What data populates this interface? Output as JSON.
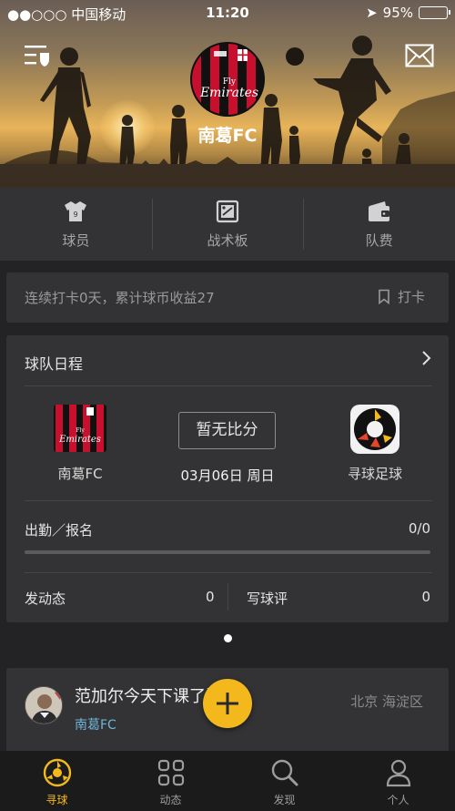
{
  "status_bar": {
    "carrier": "●●○○○ 中国移动",
    "time": "11:20",
    "battery": "95%",
    "battery_level": 0.95
  },
  "header": {
    "team_name": "南葛FC",
    "logo_brand": "Emirates",
    "logo_fly": "Fly"
  },
  "nav": [
    {
      "label": "球员",
      "icon": "jersey-icon"
    },
    {
      "label": "战术板",
      "icon": "tactics-board-icon"
    },
    {
      "label": "队费",
      "icon": "wallet-icon"
    }
  ],
  "checkin": {
    "text": "连续打卡0天，累计球币收益27",
    "button": "打卡"
  },
  "schedule": {
    "title": "球队日程",
    "home_team": "南葛FC",
    "away_team": "寻球足球",
    "score_label": "暂无比分",
    "date": "03月06日 周日",
    "attendance_label": "出勤／报名",
    "attendance_value": "0/0",
    "attendance_fraction": 0,
    "post_label": "发动态",
    "post_count": "0",
    "review_label": "写球评",
    "review_count": "0"
  },
  "feed": {
    "title": "范加尔今天下课了没有",
    "team": "南葛FC",
    "location": "北京 海淀区"
  },
  "tabbar": [
    {
      "label": "寻球",
      "icon": "ball-logo-icon",
      "active": true
    },
    {
      "label": "动态",
      "icon": "grid-icon",
      "active": false
    },
    {
      "label": "发现",
      "icon": "search-icon",
      "active": false
    },
    {
      "label": "个人",
      "icon": "person-icon",
      "active": false
    }
  ],
  "colors": {
    "accent": "#f2b81c",
    "card": "#333335",
    "background": "#232325",
    "team_link": "#6fb4d8"
  }
}
